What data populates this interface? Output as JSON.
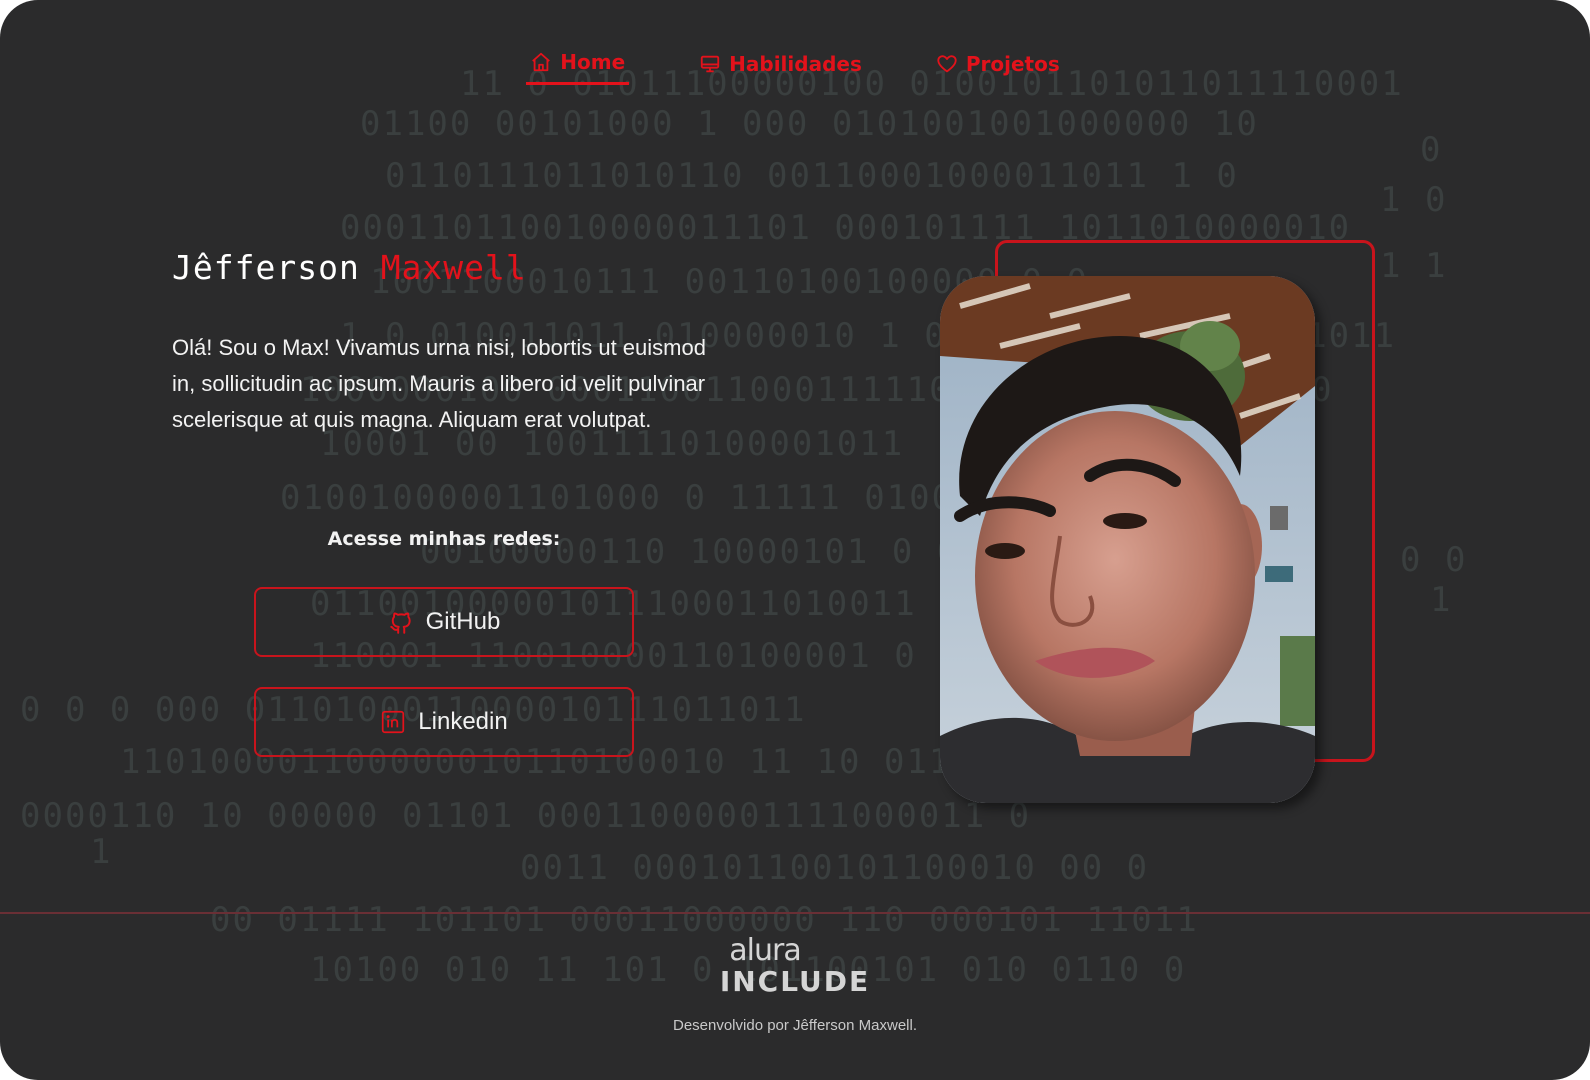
{
  "nav": {
    "items": [
      {
        "label": "Home",
        "icon": "home-icon",
        "active": true
      },
      {
        "label": "Habilidades",
        "icon": "monitor-icon",
        "active": false
      },
      {
        "label": "Projetos",
        "icon": "heart-icon",
        "active": false
      }
    ]
  },
  "profile": {
    "first_name": "Jêfferson",
    "last_name": "Maxwell",
    "bio": "Olá! Sou o Max! Vivamus urna nisi, lobortis ut euismod in, sollicitudin ac ipsum. Mauris a libero id velit pulvinar scelerisque at quis magna. Aliquam erat volutpat.",
    "photo_alt": "Jêfferson Maxwell"
  },
  "networks": {
    "label": "Acesse minhas redes:",
    "github_label": "GitHub",
    "linkedin_label": "Linkedin"
  },
  "footer": {
    "logo_top": "alura",
    "logo_bottom": "INCLUDE",
    "credit": "Desenvolvido por Jêfferson Maxwell."
  },
  "colors": {
    "accent": "#e3121b",
    "background": "#2b2b2c",
    "matrix_text": "#3a3f3f"
  }
}
